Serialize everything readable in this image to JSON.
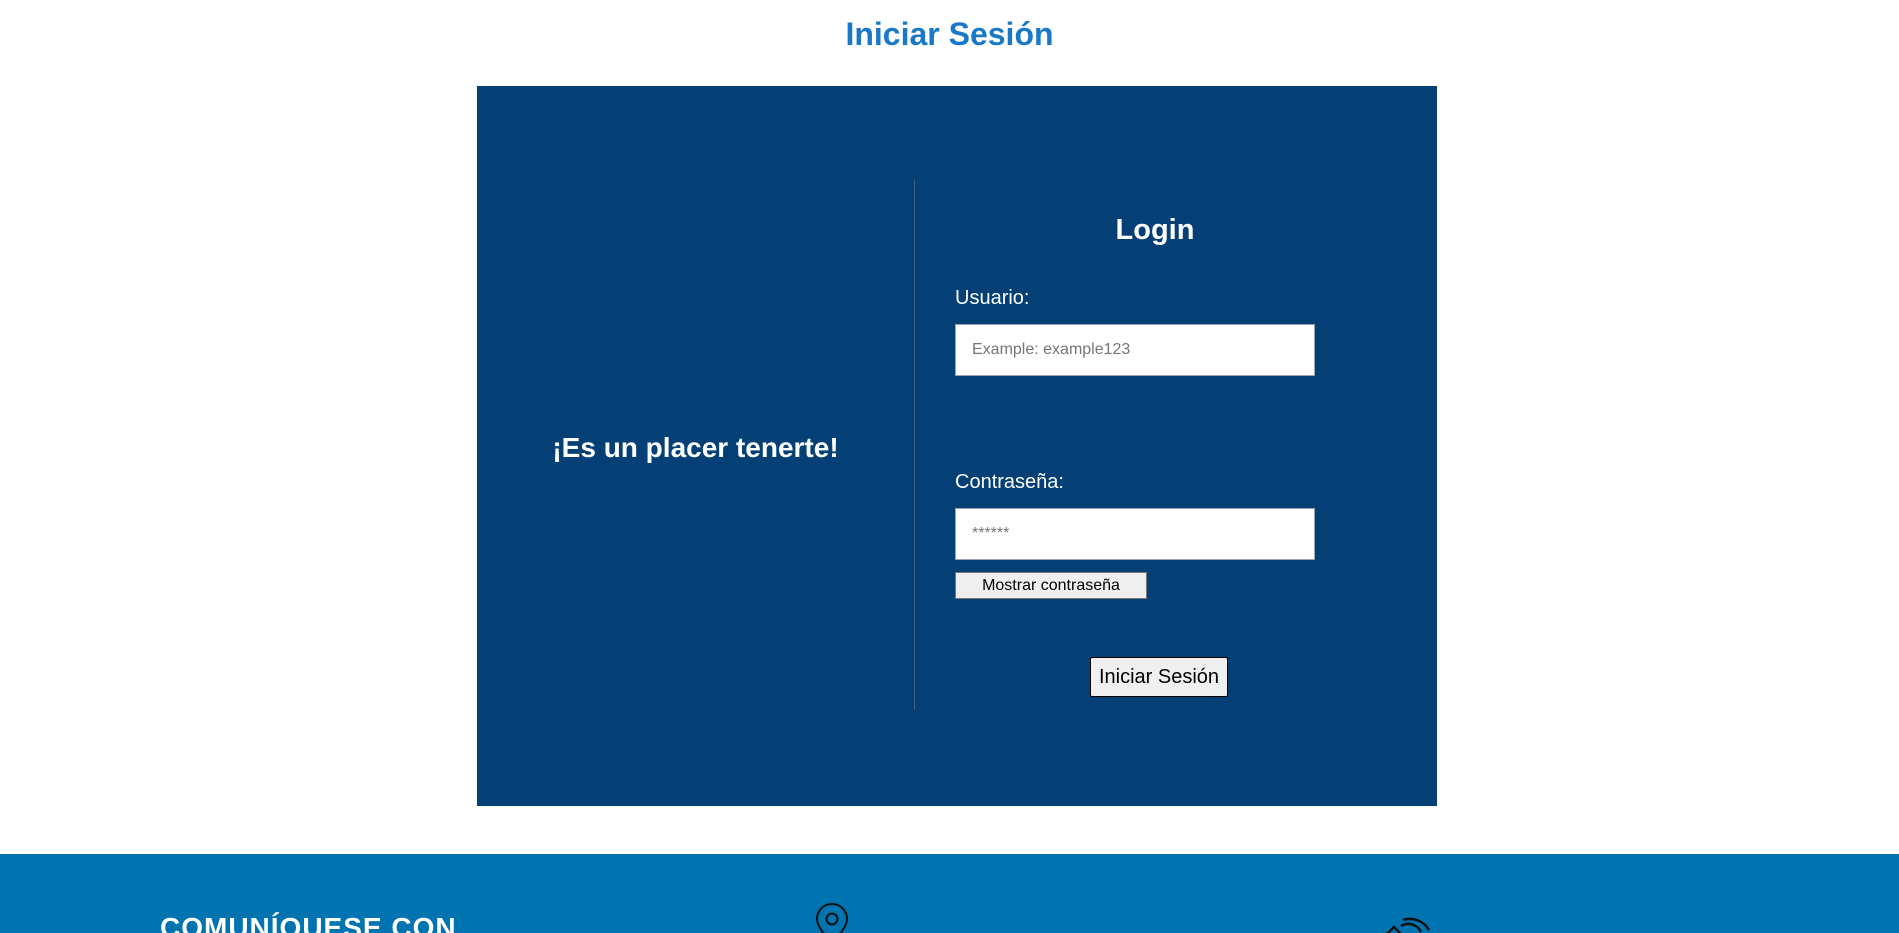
{
  "header": {
    "title": "Iniciar Sesión"
  },
  "welcome": {
    "message": "¡Es un placer tenerte!"
  },
  "login": {
    "heading": "Login",
    "username_label": "Usuario:",
    "username_placeholder": "Example: example123",
    "password_label": "Contraseña:",
    "password_placeholder": "******",
    "show_password_label": "Mostrar contraseña",
    "submit_label": "Iniciar Sesión"
  },
  "footer": {
    "heading": "COMUNÍQUESE CON",
    "icons": [
      "location-pin-icon",
      "wifi-home-icon"
    ]
  },
  "colors": {
    "title_blue": "#1a78c8",
    "panel_navy": "#043f75",
    "footer_blue": "#0073b1"
  }
}
